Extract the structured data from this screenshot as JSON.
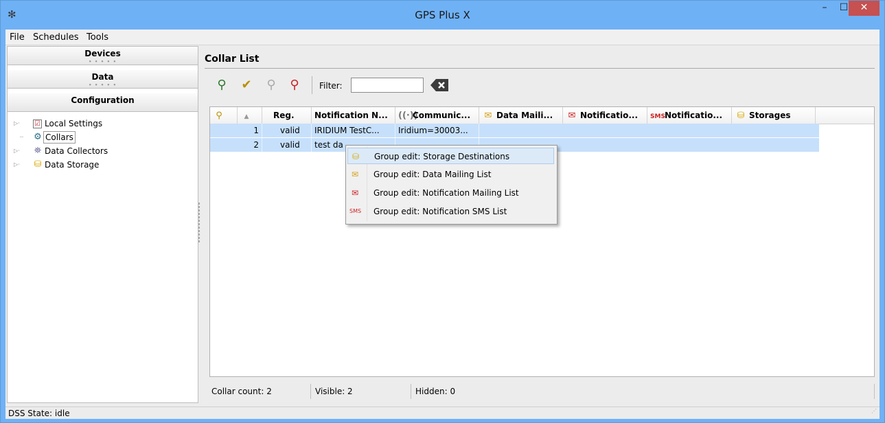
{
  "window": {
    "title": "GPS Plus X",
    "min": "–",
    "max": "☐",
    "close": "✕",
    "colors": {
      "titlebar": "#6fb1f5",
      "close": "#c75050",
      "selection": "#c6e0fb"
    }
  },
  "menu": [
    "File",
    "Schedules",
    "Tools"
  ],
  "left": {
    "sections": [
      "Devices",
      "Data",
      "Configuration"
    ],
    "tree": [
      {
        "label": "Local Settings",
        "icon": "checklist-icon",
        "expandable": true
      },
      {
        "label": "Collars",
        "icon": "collar-icon",
        "expandable": false,
        "selected": true
      },
      {
        "label": "Data Collectors",
        "icon": "satellite-icon",
        "expandable": true
      },
      {
        "label": "Data Storage",
        "icon": "database-icon",
        "expandable": true
      }
    ]
  },
  "collar_list": {
    "title": "Collar List",
    "toolbar": {
      "filter_label": "Filter:",
      "filter_value": ""
    },
    "columns": [
      "",
      "",
      "Reg.",
      "Notification N...",
      "Communic...",
      "Data Maili...",
      "Notificatio...",
      "Notificatio...",
      "Storages"
    ],
    "rows": [
      {
        "num": "1",
        "reg": "valid",
        "notif": "IRIDIUM TestC...",
        "comm": "Iridium=30003..."
      },
      {
        "num": "2",
        "reg": "valid",
        "notif": "test da",
        "comm": ""
      }
    ],
    "status": {
      "count": "Collar count: 2",
      "visible": "Visible: 2",
      "hidden": "Hidden: 0"
    }
  },
  "context_menu": [
    "Group edit: Storage Destinations",
    "Group edit: Data Mailing List",
    "Group edit: Notification Mailing List",
    "Group edit: Notification SMS List"
  ],
  "dss_state": "DSS State: idle"
}
